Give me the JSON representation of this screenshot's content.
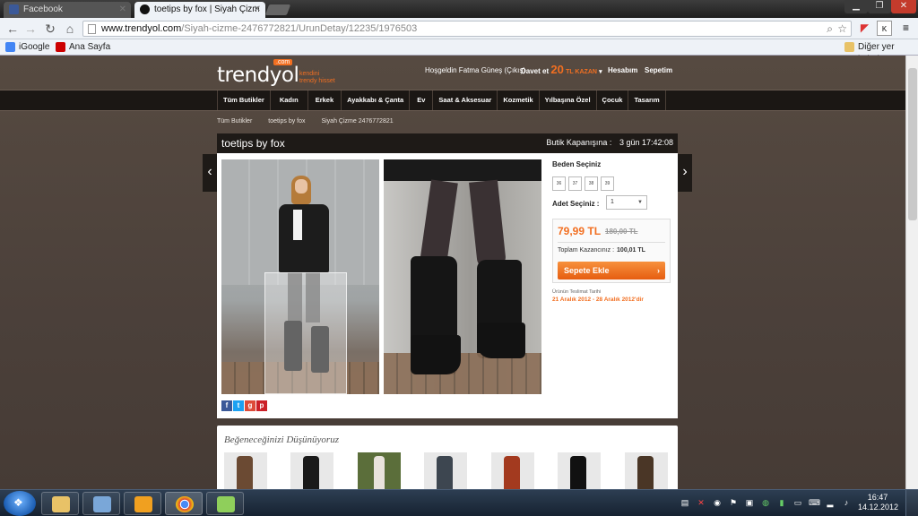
{
  "browser": {
    "tabs": [
      {
        "title": "Facebook",
        "icon": "facebook-icon",
        "active": false
      },
      {
        "title": "toetips by fox | Siyah Çizm",
        "icon": "trendyol-tab-icon",
        "active": true
      }
    ],
    "url_host": "www.trendyol.com",
    "url_path": "/Siyah-cizme-2476772821/UrunDetay/12235/1976503",
    "bookmarks": [
      {
        "label": "iGoogle",
        "icon": "google-icon"
      },
      {
        "label": "Ana Sayfa",
        "icon": "home-bookmark-icon"
      }
    ],
    "other_bookmarks": "Diğer yer imleri"
  },
  "site": {
    "logo": "trendyol",
    "logo_badge": ".com",
    "slogan": "kendini trendy hisset",
    "greeting": "Hoşgeldin Fatma Güneş",
    "logout": "(Çıkış)",
    "invite_prefix": "Davet et",
    "invite_amount": "20",
    "invite_suffix": "TL KAZAN",
    "account": "Hesabım",
    "cart": "Sepetim",
    "nav": [
      "Tüm Butikler",
      "Kadın",
      "Erkek",
      "Ayakkabı & Çanta",
      "Ev",
      "Saat & Aksesuar",
      "Kozmetik",
      "Yılbaşına Özel",
      "Çocuk",
      "Tasarım"
    ],
    "breadcrumb": [
      "Tüm Butikler",
      "toetips by fox",
      "Siyah Çizme 2476772821"
    ]
  },
  "product": {
    "boutique": "toetips by fox",
    "closing_label": "Butik Kapanışına :",
    "closing_time": "3 gün 17:42:08",
    "size_label": "Beden Seçiniz",
    "sizes": [
      "36",
      "37",
      "38",
      "39"
    ],
    "qty_label": "Adet Seçiniz :",
    "qty_value": "1",
    "price": "79,99 TL",
    "old_price": "180,00 TL",
    "savings_label": "Toplam Kazancınız :",
    "savings_value": "100,01 TL",
    "cart_button": "Sepete Ekle",
    "ship_label": "Ürünün Teslimat Tarihi",
    "ship_date": "21 Aralık 2012 - 28 Aralık 2012'dir",
    "share_icons": [
      "facebook-share-icon",
      "twitter-share-icon",
      "googleplus-share-icon",
      "pinterest-share-icon"
    ]
  },
  "recommend": {
    "title": "Beğeneceğinizi Düşünüyoruz",
    "items": [
      "brown-boot",
      "black-boot",
      "woman-photo",
      "grey-boot",
      "red-boot",
      "black-boot-2",
      "brown-boot-2"
    ]
  },
  "taskbar": {
    "time": "16:47",
    "date": "14.12.2012"
  },
  "colors": {
    "accent": "#f26f21",
    "page_bg": "#4a3f38",
    "nav_bg": "#1b1714"
  }
}
